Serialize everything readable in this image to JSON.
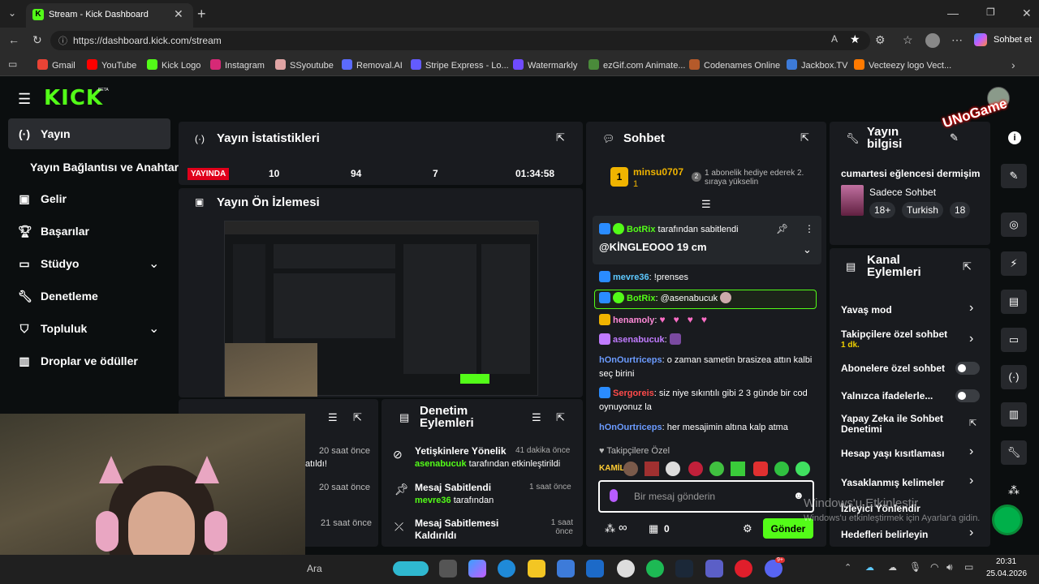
{
  "browser": {
    "tab_title": "Stream - Kick Dashboard",
    "url": "https://dashboard.kick.com/stream",
    "copilot_label": "Sohbet et",
    "bookmarks": [
      "Gmail",
      "YouTube",
      "Kick Logo",
      "Instagram",
      "SSyoutube",
      "Removal.AI",
      "Stripe Express - Lo...",
      "Watermarkly",
      "ezGif.com Animate...",
      "Codenames Online",
      "Jackbox.TV",
      "Vecteezy logo Vect..."
    ]
  },
  "app": {
    "logo": "KICK",
    "logo_badge": "BETA",
    "accent": "#53fc18"
  },
  "sidebar": {
    "items": [
      {
        "label": "Yayın",
        "icon": "broadcast-icon"
      },
      {
        "label": "Yayın Bağlantısı ve Anahtarı",
        "icon": ""
      },
      {
        "label": "Gelir",
        "icon": "revenue-icon"
      },
      {
        "label": "Başarılar",
        "icon": "trophy-icon"
      },
      {
        "label": "Stüdyo",
        "icon": "studio-icon"
      },
      {
        "label": "Denetleme",
        "icon": "wrench-icon"
      },
      {
        "label": "Topluluk",
        "icon": "community-icon"
      },
      {
        "label": "Droplar ve ödüller",
        "icon": "drops-icon"
      }
    ]
  },
  "stats": {
    "title": "Yayın İstatistikleri",
    "live_badge": "YAYINDA",
    "values": [
      "10",
      "94",
      "7",
      "01:34:58"
    ]
  },
  "preview": {
    "title": "Yayın Ön İzlemesi"
  },
  "events_panel": {
    "timestamps": [
      "20 saat önce",
      "20 saat önce",
      "21 saat önce"
    ],
    "snippet": "atıldı!"
  },
  "moderation": {
    "title": "Denetim Eylemleri",
    "items": [
      {
        "title": "Yetişkinlere Yönelik",
        "time": "41 dakika önce",
        "user": "asenabucuk",
        "desc": "tarafından etkinleştirildi"
      },
      {
        "title": "Mesaj Sabitlendi",
        "time": "1 saat önce",
        "user": "mevre36",
        "desc": "tarafından"
      },
      {
        "title": "Mesaj Sabitlemesi Kaldırıldı",
        "time": "1 saat önce",
        "user": "",
        "desc": ""
      }
    ]
  },
  "chat": {
    "title": "Sohbet",
    "gift_user": "minsu0707",
    "gift_rank": "1",
    "gift_count": "1",
    "gift_notice": "1 abonelik hediye ederek 2. sıraya yükselin",
    "pinned_by": "BotRix",
    "pinned_by_suffix": "tarafından sabitlendi",
    "pinned_text": "@KİNGLEOOO 19 cm",
    "messages": [
      {
        "user": "mevre36",
        "text": "!prenses",
        "color": "#5ec9ff"
      },
      {
        "user": "BotRix",
        "text": "@asenabucuk",
        "color": "#53fc18"
      },
      {
        "user": "henamoly",
        "text": "",
        "color": "#ff8ad8"
      },
      {
        "user": "asenabucuk",
        "text": "",
        "color": "#c07bff"
      },
      {
        "user": "hOnOurtriceps",
        "text": "o zaman sametin brasizea attın kalbi seç birini",
        "color": "#6b9bff"
      },
      {
        "user": "Sergoreis",
        "text": "siz niye sıkıntılı gibi 2 3 günde bir cod oynuyonuz la",
        "color": "#ff4b4b"
      },
      {
        "user": "hOnOurtriceps",
        "text": "her mesajimin altına kalp atma",
        "color": "#6b9bff"
      }
    ],
    "followers_label": "Takipçilere Özel",
    "emote_label": "KAMİL",
    "input_placeholder": "Bir mesaj gönderin",
    "send_label": "Gönder",
    "points": "0",
    "infinity": "∞"
  },
  "stream_info": {
    "title": "Yayın bilgisi",
    "stream_title": "cumartesi eğlencesi dermişim",
    "category": "Sadece Sohbet",
    "tags": [
      "18+",
      "Turkish",
      "18"
    ]
  },
  "channel_actions": {
    "title": "Kanal Eylemleri",
    "items": [
      {
        "label": "Yavaş mod",
        "sub": "",
        "control": "chevron"
      },
      {
        "label": "Takipçilere özel sohbet",
        "sub": "1 dk.",
        "control": "chevron"
      },
      {
        "label": "Abonelere özel sohbet",
        "sub": "",
        "control": "toggle"
      },
      {
        "label": "Yalnızca ifadelerle...",
        "sub": "",
        "control": "toggle"
      },
      {
        "label": "Yapay Zeka ile Sohbet Denetimi",
        "sub": "",
        "control": "external"
      },
      {
        "label": "Hesap yaşı kısıtlaması",
        "sub": "",
        "control": "chevron"
      },
      {
        "label": "Yasaklanmış kelimeler",
        "sub": "",
        "control": "chevron"
      },
      {
        "label": "İzleyici Yönlendir",
        "sub": "",
        "control": "none"
      },
      {
        "label": "Hedefleri belirleyin",
        "sub": "",
        "control": "chevron"
      }
    ]
  },
  "overlay": {
    "watermark_title": "Windows'u Etkinleştir",
    "watermark_sub": "Windows'u etkinleştirmek için Ayarlar'a gidin.",
    "channel_tag": "UNoGame"
  },
  "taskbar": {
    "search": "Ara",
    "time": "20:31",
    "date": "25.04.2026",
    "discord_badge": "9+"
  }
}
